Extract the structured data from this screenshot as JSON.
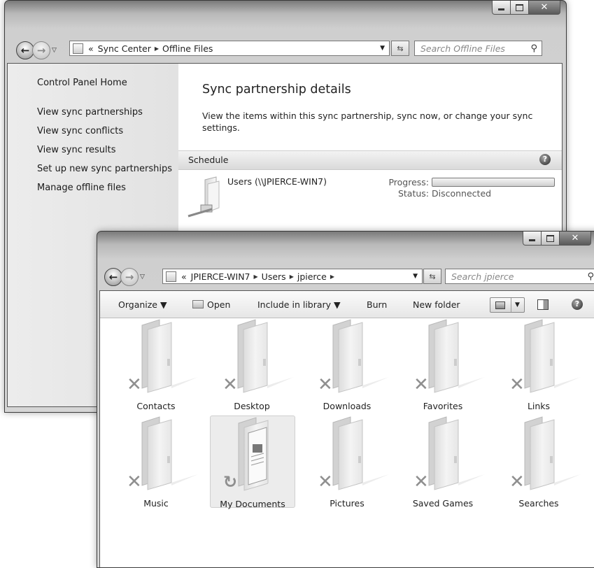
{
  "sync_window": {
    "breadcrumb": [
      "Sync Center",
      "Offline Files"
    ],
    "search_placeholder": "Search Offline Files",
    "sidebar": [
      "Control Panel Home",
      "View sync partnerships",
      "View sync conflicts",
      "View sync results",
      "Set up new sync partnerships",
      "Manage offline files"
    ],
    "heading": "Sync partnership details",
    "description": "View the items within this sync partnership, sync now, or change your sync settings.",
    "schedule_label": "Schedule",
    "item_name": "Users (\\\\JPIERCE-WIN7)",
    "progress_label": "Progress:",
    "status_label": "Status:",
    "status_value": "Disconnected",
    "progress": 0
  },
  "explorer_window": {
    "breadcrumb": [
      "JPIERCE-WIN7",
      "Users",
      "jpierce"
    ],
    "search_placeholder": "Search jpierce",
    "toolbar": {
      "organize": "Organize ▼",
      "open": "Open",
      "include": "Include in library ▼",
      "burn": "Burn",
      "new_folder": "New folder"
    },
    "folders": [
      "Contacts",
      "Desktop",
      "Downloads",
      "Favorites",
      "Links",
      "Music",
      "My Documents",
      "Pictures",
      "Saved Games",
      "Searches"
    ]
  }
}
